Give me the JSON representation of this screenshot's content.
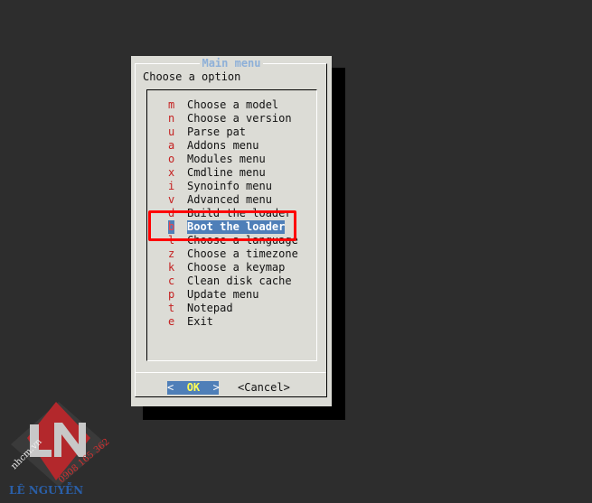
{
  "dialog": {
    "title": "Main menu",
    "prompt": "Choose a option"
  },
  "menu": [
    {
      "key": "m",
      "label": "Choose a model"
    },
    {
      "key": "n",
      "label": "Choose a version"
    },
    {
      "key": "u",
      "label": "Parse pat"
    },
    {
      "key": "a",
      "label": "Addons menu"
    },
    {
      "key": "o",
      "label": "Modules menu"
    },
    {
      "key": "x",
      "label": "Cmdline menu"
    },
    {
      "key": "i",
      "label": "Synoinfo menu"
    },
    {
      "key": "v",
      "label": "Advanced menu"
    },
    {
      "key": "d",
      "label": "Build the loader"
    },
    {
      "key": "b",
      "label": "Boot the loader",
      "selected": true
    },
    {
      "key": "l",
      "label": "Choose a language"
    },
    {
      "key": "z",
      "label": "Choose a timezone"
    },
    {
      "key": "k",
      "label": "Choose a keymap"
    },
    {
      "key": "c",
      "label": "Clean disk cache"
    },
    {
      "key": "p",
      "label": "Update menu"
    },
    {
      "key": "t",
      "label": "Notepad"
    },
    {
      "key": "e",
      "label": "Exit"
    }
  ],
  "buttons": {
    "ok_left": "<  ",
    "ok": "OK",
    "ok_right": "  >",
    "cancel": "<Cancel>"
  },
  "watermark": {
    "site": "nhcm.vn",
    "phone": "0908 165 362",
    "name": "LÊ NGUYỄN"
  },
  "colors": {
    "background": "#2d2d2d",
    "dialog": "#dcdcd6",
    "selection": "#4f7fb8",
    "hotkey": "#c42020",
    "highlight_box": "#ff0000"
  }
}
